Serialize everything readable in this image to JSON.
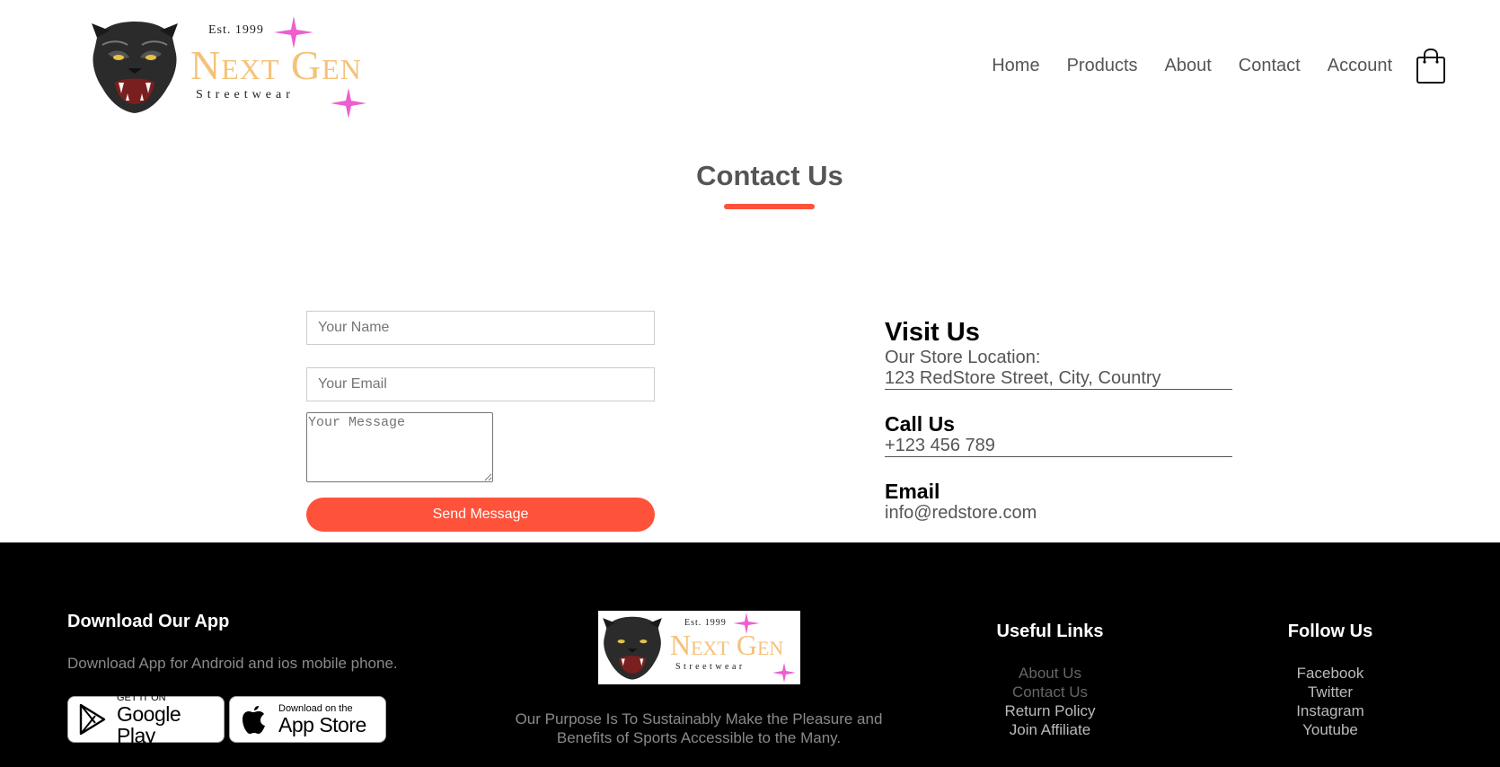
{
  "header": {
    "logo": {
      "est": "Est. 1999",
      "brand": "Next Gen",
      "sub": "Streetwear"
    },
    "nav": [
      "Home",
      "Products",
      "About",
      "Contact",
      "Account"
    ],
    "cart_icon": "shopping-bag-icon"
  },
  "page": {
    "title": "Contact Us",
    "accent_color": "#ff523b"
  },
  "form": {
    "name_placeholder": "Your Name",
    "name_value": "",
    "email_placeholder": "Your Email",
    "email_value": "",
    "message_placeholder": "Your Message",
    "message_value": "",
    "submit_label": "Send Message"
  },
  "contact_info": {
    "visit": {
      "heading": "Visit Us",
      "label": "Our Store Location:",
      "address": "123 RedStore Street, City, Country"
    },
    "call": {
      "heading": "Call Us",
      "phone": "+123 456 789"
    },
    "email": {
      "heading": "Email",
      "address": "info@redstore.com"
    }
  },
  "footer": {
    "app": {
      "title": "Download Our App",
      "description": "Download App for Android and ios mobile phone.",
      "google_play": {
        "small": "GET IT ON",
        "big": "Google Play",
        "icon": "google-play-icon"
      },
      "app_store": {
        "small": "Download on the",
        "big": "App Store",
        "icon": "apple-icon"
      }
    },
    "logo": {
      "est": "Est. 1999",
      "brand": "Next Gen",
      "sub": "Streetwear"
    },
    "purpose": "Our Purpose Is To Sustainably Make the Pleasure and Benefits of Sports Accessible to the Many.",
    "useful_links": {
      "title": "Useful Links",
      "items": [
        "About Us",
        "Contact Us",
        "Return Policy",
        "Join Affiliate"
      ]
    },
    "follow_us": {
      "title": "Follow Us",
      "items": [
        "Facebook",
        "Twitter",
        "Instagram",
        "Youtube"
      ]
    }
  }
}
